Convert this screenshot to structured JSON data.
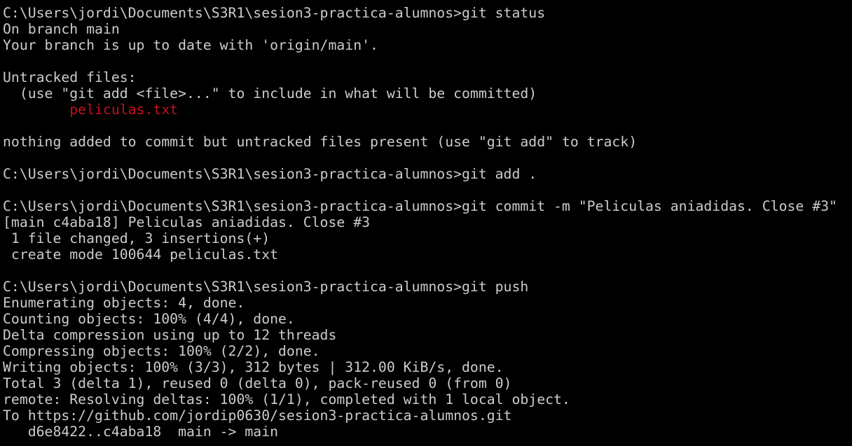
{
  "terminal": {
    "lines": [
      {
        "text": "C:\\Users\\jordi\\Documents\\S3R1\\sesion3-practica-alumnos>git status",
        "kind": "command"
      },
      {
        "text": "On branch main",
        "kind": "output"
      },
      {
        "text": "Your branch is up to date with 'origin/main'.",
        "kind": "output"
      },
      {
        "text": "",
        "kind": "blank"
      },
      {
        "text": "Untracked files:",
        "kind": "output"
      },
      {
        "text": "  (use \"git add <file>...\" to include in what will be committed)",
        "kind": "output"
      },
      {
        "text": "        peliculas.txt",
        "kind": "untracked"
      },
      {
        "text": "",
        "kind": "blank"
      },
      {
        "text": "nothing added to commit but untracked files present (use \"git add\" to track)",
        "kind": "output"
      },
      {
        "text": "",
        "kind": "blank"
      },
      {
        "text": "C:\\Users\\jordi\\Documents\\S3R1\\sesion3-practica-alumnos>git add .",
        "kind": "command"
      },
      {
        "text": "",
        "kind": "blank"
      },
      {
        "text": "C:\\Users\\jordi\\Documents\\S3R1\\sesion3-practica-alumnos>git commit -m \"Peliculas aniadidas. Close #3\"",
        "kind": "command"
      },
      {
        "text": "[main c4aba18] Peliculas aniadidas. Close #3",
        "kind": "output"
      },
      {
        "text": " 1 file changed, 3 insertions(+)",
        "kind": "output"
      },
      {
        "text": " create mode 100644 peliculas.txt",
        "kind": "output"
      },
      {
        "text": "",
        "kind": "blank"
      },
      {
        "text": "C:\\Users\\jordi\\Documents\\S3R1\\sesion3-practica-alumnos>git push",
        "kind": "command"
      },
      {
        "text": "Enumerating objects: 4, done.",
        "kind": "output"
      },
      {
        "text": "Counting objects: 100% (4/4), done.",
        "kind": "output"
      },
      {
        "text": "Delta compression using up to 12 threads",
        "kind": "output"
      },
      {
        "text": "Compressing objects: 100% (2/2), done.",
        "kind": "output"
      },
      {
        "text": "Writing objects: 100% (3/3), 312 bytes | 312.00 KiB/s, done.",
        "kind": "output"
      },
      {
        "text": "Total 3 (delta 1), reused 0 (delta 0), pack-reused 0 (from 0)",
        "kind": "output"
      },
      {
        "text": "remote: Resolving deltas: 100% (1/1), completed with 1 local object.",
        "kind": "output"
      },
      {
        "text": "To https://github.com/jordip0630/sesion3-practica-alumnos.git",
        "kind": "output"
      },
      {
        "text": "   d6e8422..c4aba18  main -> main",
        "kind": "output"
      }
    ]
  },
  "colors": {
    "background": "#000000",
    "foreground": "#cccccc",
    "untracked": "#c50f1f"
  }
}
